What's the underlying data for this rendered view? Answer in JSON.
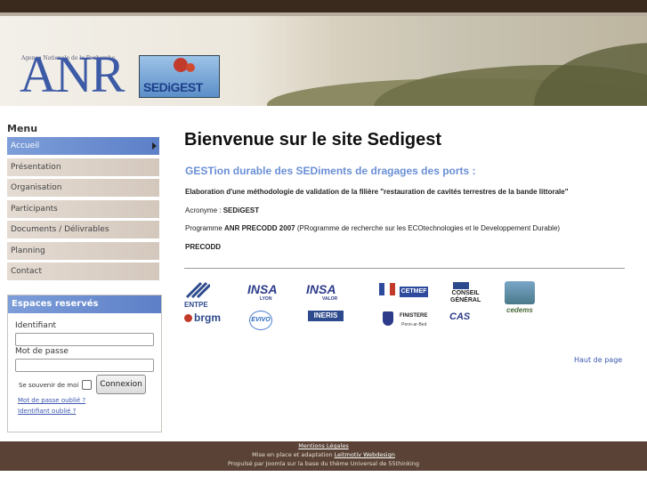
{
  "header": {
    "anr_small": "Agence Nationale de la Recherche",
    "anr_logo": "ANR",
    "sedigest_logo": "SEDiGEST"
  },
  "sidebar": {
    "menu_title": "Menu",
    "items": [
      {
        "label": "Accueil"
      },
      {
        "label": "Présentation"
      },
      {
        "label": "Organisation"
      },
      {
        "label": "Participants"
      },
      {
        "label": "Documents / Délivrables"
      },
      {
        "label": "Planning"
      },
      {
        "label": "Contact"
      }
    ]
  },
  "login": {
    "title": "Espaces reservés",
    "username_label": "Identifiant",
    "password_label": "Mot de passe",
    "remember_label": "Se souvenir de moi",
    "submit_label": "Connexion",
    "forgot_password": "Mot de passe oublié ?",
    "forgot_username": "Identifiant oublié ?"
  },
  "main": {
    "title": "Bienvenue sur le site Sedigest",
    "subtitle": "GESTion durable des SEDiments de dragages des ports :",
    "line1": "Elaboration d'une méthodologie de validation de la filière \"restauration de cavités terrestres de la bande littorale\"",
    "acronym_prefix": "Acronyme : ",
    "acronym_value": "SEDiGEST",
    "programme_prefix": "Programme ",
    "programme_bold": "ANR PRECODD 2007",
    "programme_rest": " (PRogramme de recherche sur les ECOtechnologies et le Developpement Durable)",
    "precodd": "PRECODD",
    "top_link": "Haut de page"
  },
  "partners": {
    "entpe": "ENTPE",
    "brgm": "brgm",
    "insa_lyon": "INSA",
    "insa_lyon_sub": "LYON",
    "evivo": "EVIVO",
    "insa_valor": "INSA",
    "insa_valor_sub": "VALOR",
    "ineris": "INERIS",
    "cetmef": "CETMEF",
    "finistere": "FINISTERE",
    "finistere_sub": "Penn-ar-Bed",
    "cg_top": "CONSEIL",
    "cg_bottom": "GÉNÉRAL",
    "cas": "CAS",
    "cedems": "cedems"
  },
  "footer": {
    "mentions": "Mentions Légales",
    "line2_prefix": "Mise en place et adaptation ",
    "line2_link": "Leitmotiv Webdesign",
    "line3": "Propulsé par Joomla sur la base du thème Universal de 55thinking"
  },
  "colors": {
    "accent_blue": "#6a8fd6",
    "menu_active": "#7d9ed9",
    "footer_bg": "#5a4336",
    "top_bar": "#3a2a1e"
  }
}
